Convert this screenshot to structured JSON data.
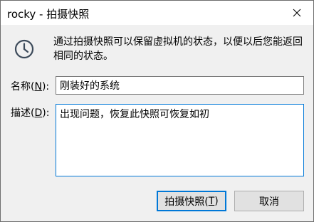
{
  "window": {
    "title": "rocky - 拍摄快照",
    "close_icon": "close-icon"
  },
  "info": {
    "icon": "clock-icon",
    "text": "通过拍摄快照可以保留虚拟机的状态，以便以后您能返回相同的状态。"
  },
  "form": {
    "name_label": "名称(",
    "name_mnemonic": "N",
    "name_label_end": "):",
    "name_value": "刚装好的系统",
    "desc_label": "描述(",
    "desc_mnemonic": "D",
    "desc_label_end": "):",
    "desc_value": "出现问题，恢复此快照可恢复如初"
  },
  "buttons": {
    "take_snapshot_label": "拍摄快照(",
    "take_snapshot_mnemonic": "T",
    "take_snapshot_end": ")",
    "cancel_label": "取消"
  }
}
